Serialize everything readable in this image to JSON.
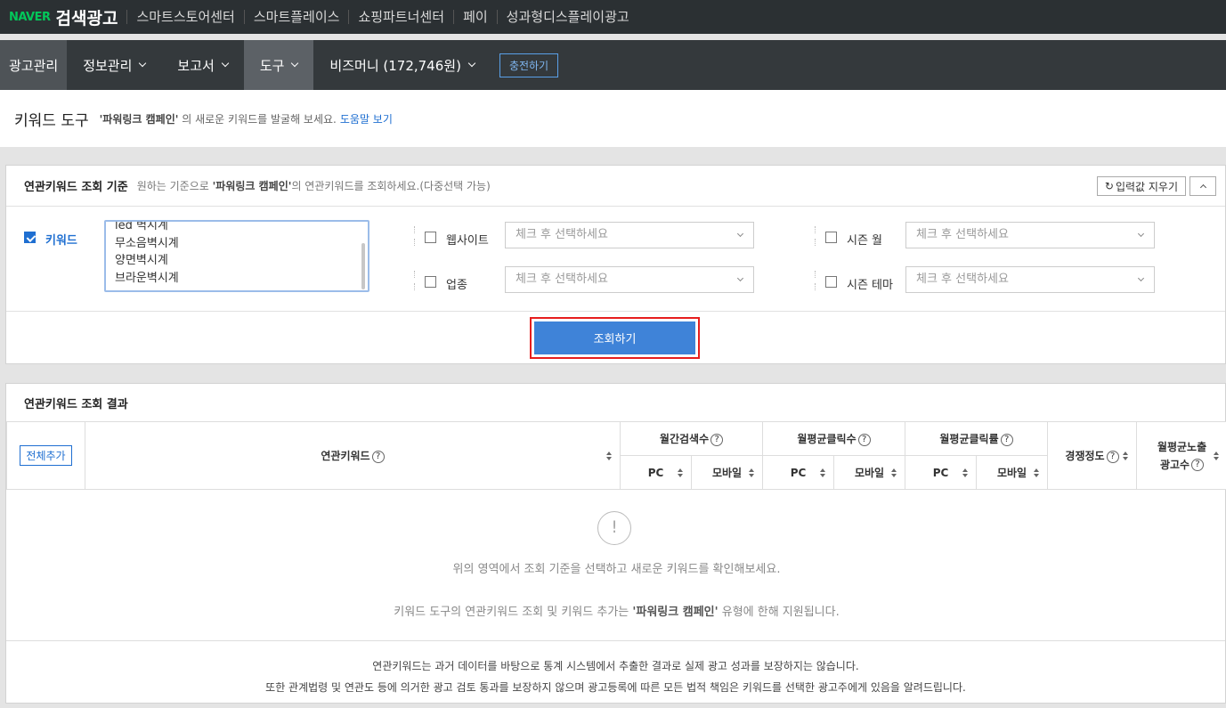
{
  "topbar": {
    "brand": "NAVER",
    "title": "검색광고",
    "links": [
      "스마트스토어센터",
      "스마트플레이스",
      "쇼핑파트너센터",
      "페이",
      "성과형디스플레이광고"
    ]
  },
  "nav": {
    "items": [
      "광고관리",
      "정보관리",
      "보고서",
      "도구"
    ],
    "bizmoney": "비즈머니 (172,746원)",
    "charge": "충전하기"
  },
  "page": {
    "title": "키워드 도구",
    "desc_campaign": "'파워링크 캠페인'",
    "desc_rest": " 의 새로운 키워드를 발굴해 보세요.",
    "help": "도움말 보기"
  },
  "criteria": {
    "title": "연관키워드 조회 기준",
    "sub_pre": "원하는 기준으로 ",
    "sub_campaign": "'파워링크 캠페인'",
    "sub_post": "의 연관키워드를 조회하세요.(다중선택 가능)",
    "reset": "입력값 지우기",
    "keyword_label": "키워드",
    "keywords": [
      "led 벽시계",
      "무소음벽시계",
      "양면벽시계",
      "브라운벽시계"
    ],
    "website_label": "웹사이트",
    "industry_label": "업종",
    "season_month_label": "시즌 월",
    "season_theme_label": "시즌 테마",
    "select_placeholder": "체크 후 선택하세요",
    "search_button": "조회하기"
  },
  "results": {
    "title": "연관키워드 조회 결과",
    "add_all": "전체추가",
    "col_keyword": "연관키워드",
    "col_monthly_search": "월간검색수",
    "col_avg_clicks": "월평균클릭수",
    "col_avg_ctr": "월평균클릭률",
    "col_competition": "경쟁정도",
    "col_ad_count_1": "월평균노출",
    "col_ad_count_2": "광고수",
    "pc": "PC",
    "mobile": "모바일",
    "question_mark": "?",
    "exclamation": "!",
    "empty_1": "위의 영역에서 조회 기준을 선택하고 새로운 키워드를 확인해보세요.",
    "empty_2_pre": "키워드 도구의 연관키워드 조회 및 키워드 추가는 ",
    "empty_2_campaign": "'파워링크 캠페인'",
    "empty_2_post": " 유형에 한해 지원됩니다.",
    "notice_1": "연관키워드는 과거 데이터를 바탕으로 통계 시스템에서 추출한 결과로 실제 광고 성과를 보장하지는 않습니다.",
    "notice_2": "또한 관계법령 및 연관도 등에 의거한 광고 검토 통과를 보장하지 않으며 광고등록에 따른 모든 법적 책임은 키워드를 선택한 광고주에게 있음을 알려드립니다."
  }
}
